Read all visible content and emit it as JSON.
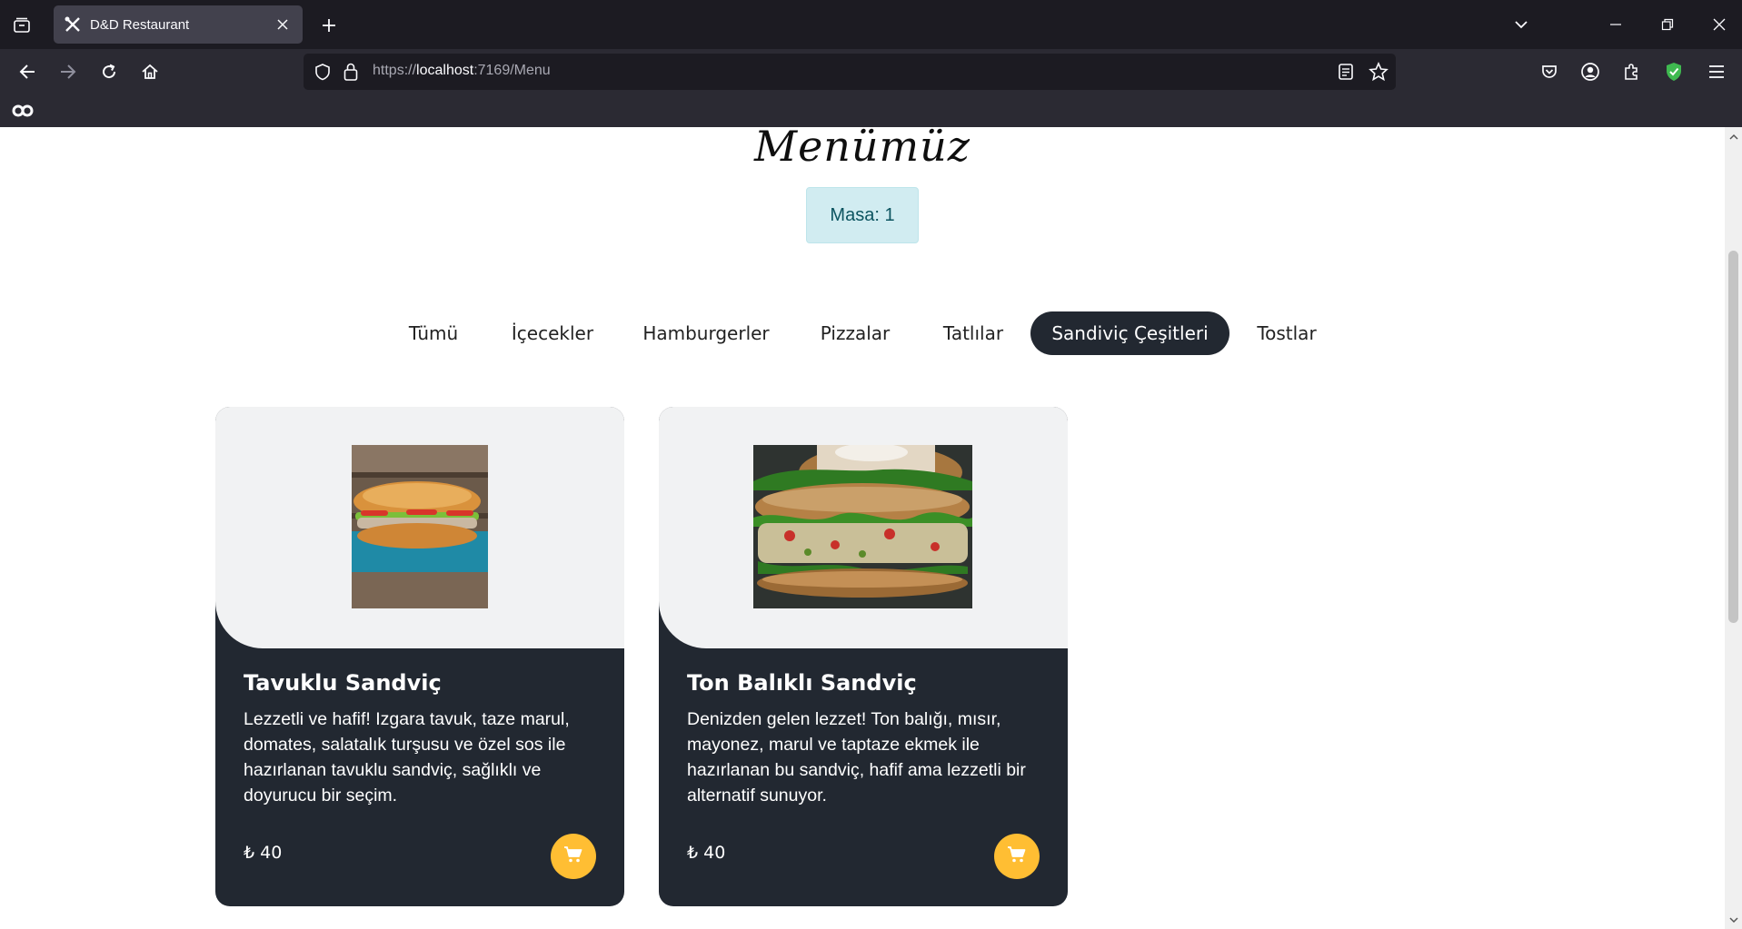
{
  "browser": {
    "tab_title": "D&D Restaurant",
    "url_scheme_host_prefix": "https://",
    "url_host": "localhost",
    "url_rest": ":7169/Menu"
  },
  "page": {
    "title": "Menümüz",
    "table_badge": "Masa: 1",
    "filters": [
      {
        "label": "Tümü",
        "active": false
      },
      {
        "label": "İçecekler",
        "active": false
      },
      {
        "label": "Hamburgerler",
        "active": false
      },
      {
        "label": "Pizzalar",
        "active": false
      },
      {
        "label": "Tatlılar",
        "active": false
      },
      {
        "label": "Sandiviç Çeşitleri",
        "active": true
      },
      {
        "label": "Tostlar",
        "active": false
      }
    ],
    "products": [
      {
        "name": "Tavuklu Sandviç",
        "description": "Lezzetli ve hafif! Izgara tavuk, taze marul, domates, salatalık turşusu ve özel sos ile hazırlanan tavuklu sandviç, sağlıklı ve doyurucu bir seçim.",
        "price": "₺ 40",
        "image": "chicken-sandwich-photo"
      },
      {
        "name": "Ton Balıklı Sandviç",
        "description": "Denizden gelen lezzet! Ton balığı, mısır, mayonez, marul ve taptaze ekmek ile hazırlanan bu sandviç, hafif ama lezzetli bir alternatif sunuyor.",
        "price": "₺ 40",
        "image": "tuna-sandwich-photo"
      }
    ]
  },
  "colors": {
    "accent_yellow": "#ffbe33",
    "card_dark": "#222831",
    "badge_bg": "#d1ecf1",
    "badge_text": "#0c5460"
  }
}
